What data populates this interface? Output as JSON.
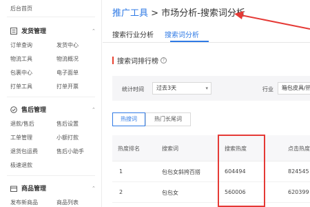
{
  "sidebar": {
    "home": "后台首页",
    "sections": [
      {
        "title": "发货管理",
        "icon": "list-icon",
        "items": [
          "订单查询",
          "发货中心",
          "物流工具",
          "物流概况",
          "包裹中心",
          "电子面单",
          "打单工具",
          "打单开票"
        ]
      },
      {
        "title": "售后管理",
        "icon": "check-circle-icon",
        "items": [
          "退款/售后",
          "售后设置",
          "工单管理",
          "小额打款",
          "退货包运费",
          "售后小助手",
          "极速退款"
        ]
      },
      {
        "title": "商品管理",
        "icon": "box-icon",
        "items": [
          "发布新商品",
          "商品列表"
        ]
      }
    ]
  },
  "breadcrumb": {
    "link": "推广工具",
    "separator": " > ",
    "current": "市场分析-搜索词分析"
  },
  "top_tabs": [
    "搜索行业分析",
    "搜索词分析"
  ],
  "section_title": "搜索词排行榜",
  "filters": {
    "time_label": "统计时间",
    "time_value": "过去3天",
    "industry_label": "行业",
    "industry_value": "箱包皮具/热销女包"
  },
  "segments": [
    "热搜词",
    "热门长尾词"
  ],
  "table": {
    "headers": [
      "热度排名",
      "搜索词",
      "搜索热度",
      "点击热度"
    ],
    "rows": [
      [
        "1",
        "包包女斜挎百搭",
        "604494",
        "824545"
      ],
      [
        "2",
        "包包女",
        "560006",
        "620399"
      ]
    ]
  },
  "colors": {
    "accent": "#2f7ae5",
    "annotation": "#e53935"
  }
}
